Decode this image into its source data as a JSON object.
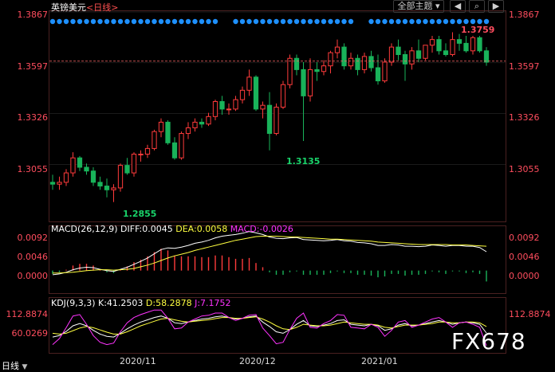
{
  "header": {
    "symbol": "英镑美元",
    "period": "<日线>",
    "theme_label": "全部主题",
    "theme_dropdown_icon": "chevron-down-icon",
    "nav_prev_icon": "chevron-left-icon",
    "nav_next_icon": "chevron-right-icon"
  },
  "price_panel": {
    "y_ticks": [
      "1.3867",
      "1.3597",
      "1.3326",
      "1.3055"
    ],
    "high_label": "1.3759",
    "low_label_1": "1.2855",
    "low_label_2": "1.3135",
    "last_price": 1.3605
  },
  "macd_panel": {
    "label": "MACD(26,12,9)",
    "diff": "DIFF:0.0045",
    "dea": "DEA:0.0058",
    "macd": "MACD:-0.0026",
    "y_ticks": [
      "0.0092",
      "0.0046",
      "0.0000"
    ]
  },
  "kdj_panel": {
    "label": "KDJ(9,3,3)",
    "k": "K:41.2503",
    "d": "D:58.2878",
    "j": "J:7.1752",
    "y_ticks": [
      "112.8874",
      "60.0269"
    ]
  },
  "x_axis": [
    "2020/11",
    "2020/12",
    "2021/01"
  ],
  "footer": {
    "daily": "日线",
    "menu_icon": "caret-down-icon",
    "watermark": "FX678"
  },
  "colors": {
    "up": "#ff3b3b",
    "down": "#19b35a",
    "accent": "#1e90ff",
    "macd": "#ffffff",
    "signal": "#ffff40",
    "jline": "#ff33ff"
  },
  "chart_data": [
    {
      "type": "candlestick",
      "title": "英镑美元 <日线>",
      "ylim": [
        1.276,
        1.3867
      ],
      "y_ticks": [
        1.3867,
        1.3597,
        1.3326,
        1.3055
      ],
      "annotations": [
        {
          "text": "1.3759",
          "kind": "high"
        },
        {
          "text": "1.2855",
          "kind": "low"
        },
        {
          "text": "1.3135",
          "kind": "low"
        }
      ],
      "ohlc": [
        [
          1.296,
          1.3,
          1.292,
          1.295
        ],
        [
          1.295,
          1.299,
          1.292,
          1.296
        ],
        [
          1.296,
          1.303,
          1.294,
          1.301
        ],
        [
          1.301,
          1.312,
          1.299,
          1.309
        ],
        [
          1.309,
          1.31,
          1.302,
          1.304
        ],
        [
          1.304,
          1.306,
          1.3,
          1.302
        ],
        [
          1.302,
          1.304,
          1.294,
          1.296
        ],
        [
          1.296,
          1.299,
          1.292,
          1.294
        ],
        [
          1.294,
          1.298,
          1.288,
          1.292
        ],
        [
          1.292,
          1.295,
          1.2855,
          1.293
        ],
        [
          1.293,
          1.306,
          1.291,
          1.305
        ],
        [
          1.305,
          1.309,
          1.3,
          1.301
        ],
        [
          1.301,
          1.312,
          1.299,
          1.311
        ],
        [
          1.311,
          1.313,
          1.307,
          1.311
        ],
        [
          1.311,
          1.316,
          1.309,
          1.314
        ],
        [
          1.314,
          1.324,
          1.313,
          1.323
        ],
        [
          1.323,
          1.33,
          1.32,
          1.328
        ],
        [
          1.328,
          1.329,
          1.316,
          1.317
        ],
        [
          1.317,
          1.32,
          1.308,
          1.309
        ],
        [
          1.309,
          1.323,
          1.308,
          1.322
        ],
        [
          1.322,
          1.328,
          1.319,
          1.325
        ],
        [
          1.325,
          1.33,
          1.323,
          1.328
        ],
        [
          1.328,
          1.33,
          1.325,
          1.327
        ],
        [
          1.327,
          1.333,
          1.326,
          1.331
        ],
        [
          1.331,
          1.34,
          1.329,
          1.339
        ],
        [
          1.339,
          1.342,
          1.332,
          1.335
        ],
        [
          1.335,
          1.338,
          1.332,
          1.335
        ],
        [
          1.335,
          1.342,
          1.334,
          1.34
        ],
        [
          1.34,
          1.347,
          1.338,
          1.345
        ],
        [
          1.345,
          1.356,
          1.342,
          1.352
        ],
        [
          1.352,
          1.353,
          1.334,
          1.335
        ],
        [
          1.335,
          1.339,
          1.33,
          1.337
        ],
        [
          1.337,
          1.344,
          1.313,
          1.322
        ],
        [
          1.322,
          1.338,
          1.321,
          1.336
        ],
        [
          1.336,
          1.35,
          1.335,
          1.348
        ],
        [
          1.348,
          1.364,
          1.346,
          1.362
        ],
        [
          1.362,
          1.364,
          1.353,
          1.356
        ],
        [
          1.356,
          1.36,
          1.318,
          1.342
        ],
        [
          1.342,
          1.362,
          1.339,
          1.356
        ],
        [
          1.356,
          1.36,
          1.35,
          1.355
        ],
        [
          1.355,
          1.361,
          1.353,
          1.358
        ],
        [
          1.358,
          1.366,
          1.354,
          1.365
        ],
        [
          1.365,
          1.372,
          1.362,
          1.368
        ],
        [
          1.368,
          1.37,
          1.356,
          1.358
        ],
        [
          1.358,
          1.365,
          1.356,
          1.362
        ],
        [
          1.362,
          1.364,
          1.353,
          1.356
        ],
        [
          1.356,
          1.365,
          1.354,
          1.363
        ],
        [
          1.363,
          1.366,
          1.355,
          1.357
        ],
        [
          1.357,
          1.364,
          1.348,
          1.35
        ],
        [
          1.35,
          1.362,
          1.349,
          1.36
        ],
        [
          1.36,
          1.37,
          1.358,
          1.368
        ],
        [
          1.368,
          1.372,
          1.361,
          1.364
        ],
        [
          1.364,
          1.366,
          1.35,
          1.359
        ],
        [
          1.359,
          1.368,
          1.356,
          1.366
        ],
        [
          1.366,
          1.372,
          1.36,
          1.362
        ],
        [
          1.362,
          1.369,
          1.361,
          1.369
        ],
        [
          1.369,
          1.374,
          1.365,
          1.372
        ],
        [
          1.372,
          1.374,
          1.364,
          1.366
        ],
        [
          1.366,
          1.37,
          1.363,
          1.364
        ],
        [
          1.364,
          1.3759,
          1.363,
          1.372
        ],
        [
          1.372,
          1.375,
          1.366,
          1.37
        ],
        [
          1.37,
          1.374,
          1.365,
          1.366
        ],
        [
          1.366,
          1.374,
          1.364,
          1.373
        ],
        [
          1.373,
          1.374,
          1.365,
          1.366
        ],
        [
          1.366,
          1.368,
          1.358,
          1.36
        ]
      ]
    },
    {
      "type": "line",
      "title": "MACD(26,12,9)",
      "ylim": [
        -0.005,
        0.01
      ],
      "series": [
        {
          "name": "DIFF",
          "values": [
            -0.001,
            -0.0008,
            -0.0004,
            0.0002,
            0.0006,
            0.0008,
            0.0007,
            0.0003,
            0.0,
            -0.0002,
            0.0003,
            0.0008,
            0.0015,
            0.0022,
            0.003,
            0.004,
            0.005,
            0.0054,
            0.0053,
            0.0056,
            0.006,
            0.0065,
            0.0068,
            0.0072,
            0.0078,
            0.0082,
            0.0084,
            0.0086,
            0.0089,
            0.0093,
            0.009,
            0.0086,
            0.008,
            0.0077,
            0.0076,
            0.0078,
            0.0079,
            0.0074,
            0.0073,
            0.0072,
            0.0071,
            0.0072,
            0.0074,
            0.0071,
            0.007,
            0.0067,
            0.0066,
            0.0064,
            0.006,
            0.006,
            0.0062,
            0.0061,
            0.0058,
            0.0058,
            0.0057,
            0.0058,
            0.0061,
            0.006,
            0.0058,
            0.006,
            0.006,
            0.0058,
            0.0058,
            0.0055,
            0.0045
          ]
        },
        {
          "name": "DEA",
          "values": [
            -0.0006,
            -0.0006,
            -0.0005,
            -0.0004,
            -0.0002,
            0.0,
            0.0001,
            0.0002,
            0.0002,
            0.0001,
            0.0002,
            0.0003,
            0.0005,
            0.0009,
            0.0013,
            0.0018,
            0.0024,
            0.003,
            0.0035,
            0.0039,
            0.0043,
            0.0048,
            0.0052,
            0.0056,
            0.006,
            0.0064,
            0.0068,
            0.0072,
            0.0075,
            0.0078,
            0.0081,
            0.0082,
            0.0082,
            0.0082,
            0.0081,
            0.008,
            0.008,
            0.0079,
            0.0078,
            0.0077,
            0.0076,
            0.0075,
            0.0075,
            0.0074,
            0.0073,
            0.0072,
            0.0071,
            0.007,
            0.0068,
            0.0067,
            0.0066,
            0.0065,
            0.0064,
            0.0063,
            0.0062,
            0.0062,
            0.0062,
            0.0062,
            0.0062,
            0.0061,
            0.0061,
            0.0061,
            0.006,
            0.0059,
            0.0058
          ]
        }
      ],
      "y_ticks": [
        0.0092,
        0.0046,
        0.0
      ]
    },
    {
      "type": "line",
      "title": "KDJ(9,3,3)",
      "ylim": [
        -10,
        130
      ],
      "series": [
        {
          "name": "K",
          "values": [
            30,
            34,
            45,
            60,
            66,
            60,
            48,
            38,
            32,
            30,
            40,
            52,
            62,
            70,
            76,
            82,
            86,
            80,
            68,
            66,
            70,
            74,
            78,
            80,
            84,
            86,
            82,
            78,
            80,
            84,
            86,
            70,
            58,
            44,
            40,
            50,
            64,
            74,
            60,
            58,
            62,
            66,
            74,
            76,
            64,
            62,
            60,
            64,
            60,
            48,
            52,
            62,
            66,
            60,
            62,
            66,
            70,
            74,
            70,
            64,
            68,
            70,
            68,
            64,
            41
          ]
        },
        {
          "name": "D",
          "values": [
            40,
            38,
            40,
            47,
            54,
            58,
            55,
            49,
            43,
            38,
            38,
            44,
            52,
            60,
            66,
            72,
            78,
            80,
            76,
            72,
            70,
            72,
            74,
            76,
            79,
            82,
            82,
            80,
            80,
            82,
            84,
            78,
            70,
            60,
            52,
            50,
            56,
            64,
            62,
            60,
            60,
            62,
            66,
            70,
            68,
            66,
            64,
            64,
            62,
            56,
            54,
            58,
            62,
            62,
            62,
            64,
            66,
            70,
            70,
            68,
            68,
            70,
            70,
            68,
            58
          ]
        },
        {
          "name": "J",
          "values": [
            10,
            26,
            55,
            86,
            90,
            64,
            34,
            16,
            10,
            14,
            44,
            68,
            82,
            90,
            96,
            102,
            102,
            80,
            52,
            54,
            70,
            78,
            86,
            88,
            94,
            94,
            82,
            74,
            80,
            88,
            90,
            54,
            34,
            12,
            16,
            50,
            80,
            94,
            56,
            54,
            66,
            74,
            90,
            88,
            56,
            54,
            52,
            64,
            56,
            32,
            48,
            70,
            74,
            56,
            62,
            70,
            78,
            82,
            70,
            56,
            68,
            70,
            64,
            56,
            7
          ]
        }
      ],
      "y_ticks": [
        112.8874,
        60.0269
      ]
    }
  ]
}
